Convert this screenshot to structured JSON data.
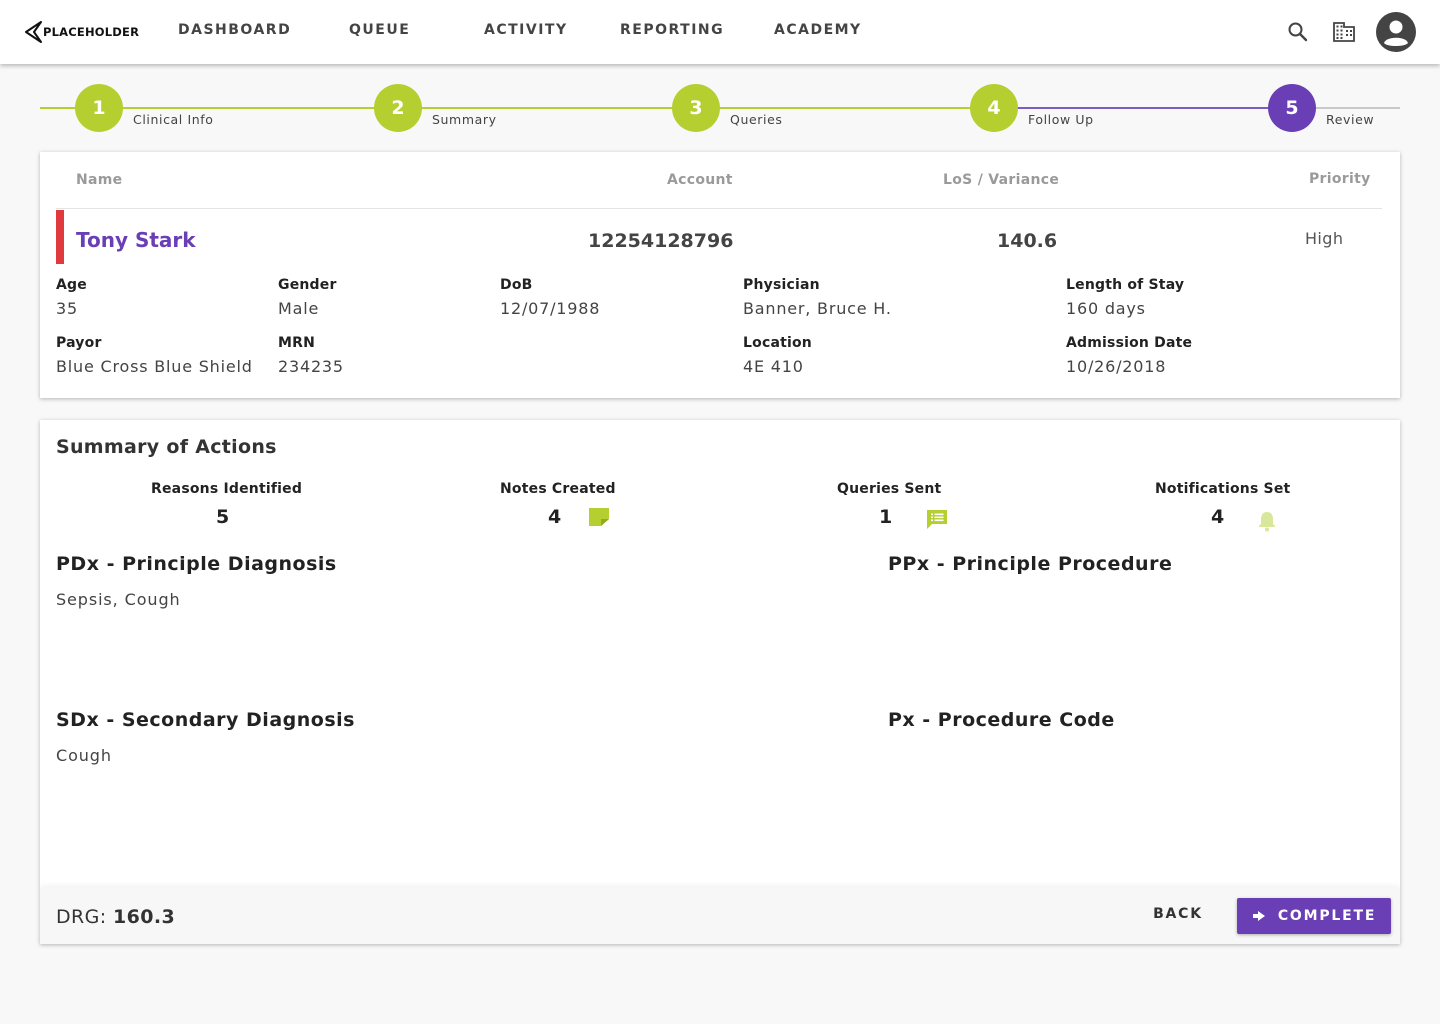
{
  "colors": {
    "accent_green": "#b5cf31",
    "accent_purple": "#6a3fb5",
    "priority_red": "#e0393e"
  },
  "nav": {
    "logo_text": "PLACEHOLDER",
    "items": [
      {
        "label": "DASHBOARD"
      },
      {
        "label": "QUEUE"
      },
      {
        "label": "ACTIVITY"
      },
      {
        "label": "REPORTING"
      },
      {
        "label": "ACADEMY"
      }
    ],
    "icons": [
      "search-icon",
      "building-icon",
      "account-icon"
    ]
  },
  "stepper": {
    "steps": [
      {
        "number": "1",
        "label": "Clinical Info",
        "state": "complete"
      },
      {
        "number": "2",
        "label": "Summary",
        "state": "complete"
      },
      {
        "number": "3",
        "label": "Queries",
        "state": "complete"
      },
      {
        "number": "4",
        "label": "Follow Up",
        "state": "complete"
      },
      {
        "number": "5",
        "label": "Review",
        "state": "active"
      }
    ]
  },
  "patient": {
    "headers": {
      "name": "Name",
      "account": "Account",
      "los": "LoS / Variance",
      "priority": "Priority"
    },
    "name": "Tony Stark",
    "account": "12254128796",
    "los": "140.6",
    "priority": "High",
    "fields": {
      "age": {
        "label": "Age",
        "value": "35"
      },
      "gender": {
        "label": "Gender",
        "value": "Male"
      },
      "dob": {
        "label": "DoB",
        "value": "12/07/1988"
      },
      "physician": {
        "label": "Physician",
        "value": "Banner, Bruce H."
      },
      "length_of_stay": {
        "label": "Length of Stay",
        "value": "160 days"
      },
      "payor": {
        "label": "Payor",
        "value": "Blue Cross Blue Shield"
      },
      "mrn": {
        "label": "MRN",
        "value": "234235"
      },
      "location": {
        "label": "Location",
        "value": "4E 410"
      },
      "admission_date": {
        "label": "Admission Date",
        "value": "10/26/2018"
      }
    }
  },
  "summary": {
    "title": "Summary of Actions",
    "stats": {
      "reasons": {
        "label": "Reasons Identified",
        "value": "5"
      },
      "notes": {
        "label": "Notes Created",
        "value": "4",
        "icon": "note-icon"
      },
      "queries": {
        "label": "Queries Sent",
        "value": "1",
        "icon": "message-icon"
      },
      "notifications": {
        "label": "Notifications Set",
        "value": "4",
        "icon": "bell-icon"
      }
    },
    "pdx": {
      "title": "PDx - Principle Diagnosis",
      "value": "Sepsis, Cough"
    },
    "ppx": {
      "title": "PPx - Principle Procedure",
      "value": ""
    },
    "sdx": {
      "title": "SDx - Secondary Diagnosis",
      "value": "Cough"
    },
    "px": {
      "title": "Px - Procedure Code",
      "value": ""
    }
  },
  "footer": {
    "drg_label": "DRG:",
    "drg_value": "160.3",
    "back_label": "BACK",
    "complete_label": "COMPLETE"
  }
}
